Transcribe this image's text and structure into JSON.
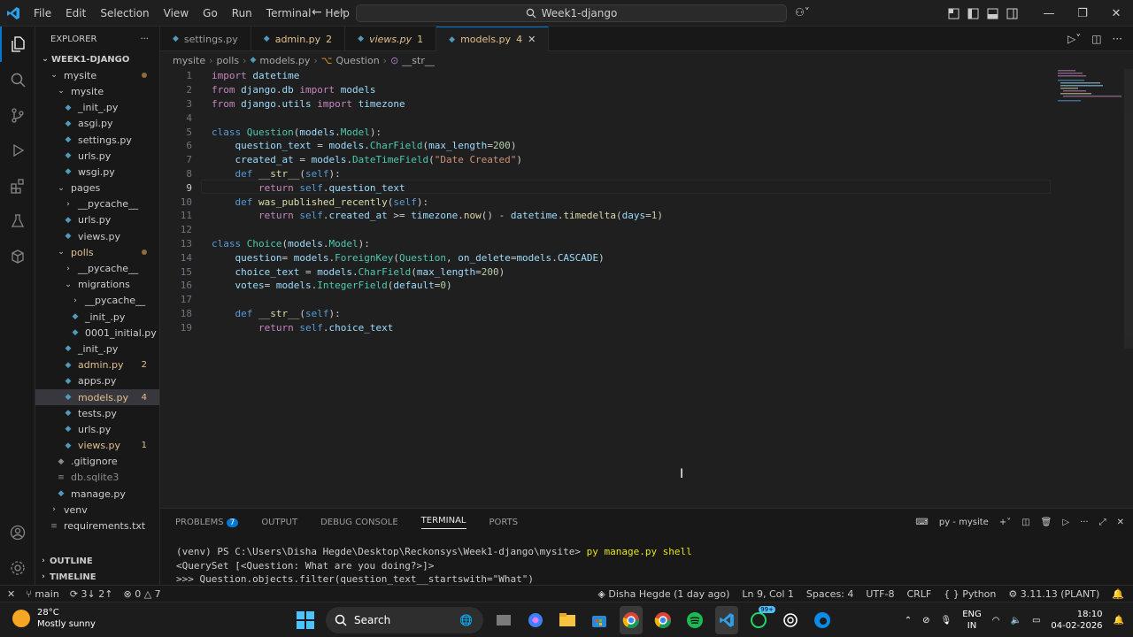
{
  "titlebar": {
    "menu": [
      "File",
      "Edit",
      "Selection",
      "View",
      "Go",
      "Run",
      "Terminal",
      "Help"
    ],
    "search_text": "Week1-django"
  },
  "sidebar": {
    "header": "EXPLORER",
    "root": "WEEK1-DJANGO",
    "tree": [
      {
        "label": "mysite",
        "depth": 0,
        "type": "folder",
        "open": true,
        "status": "dot"
      },
      {
        "label": "mysite",
        "depth": 1,
        "type": "folder",
        "open": true
      },
      {
        "label": "_init_.py",
        "depth": 2,
        "type": "py"
      },
      {
        "label": "asgi.py",
        "depth": 2,
        "type": "py"
      },
      {
        "label": "settings.py",
        "depth": 2,
        "type": "py"
      },
      {
        "label": "urls.py",
        "depth": 2,
        "type": "py"
      },
      {
        "label": "wsgi.py",
        "depth": 2,
        "type": "py"
      },
      {
        "label": "pages",
        "depth": 1,
        "type": "folder",
        "open": true
      },
      {
        "label": "__pycache__",
        "depth": 2,
        "type": "folder",
        "open": false
      },
      {
        "label": "urls.py",
        "depth": 2,
        "type": "py"
      },
      {
        "label": "views.py",
        "depth": 2,
        "type": "py"
      },
      {
        "label": "polls",
        "depth": 1,
        "type": "folder",
        "open": true,
        "status": "dot",
        "mod": true
      },
      {
        "label": "__pycache__",
        "depth": 2,
        "type": "folder",
        "open": false
      },
      {
        "label": "migrations",
        "depth": 2,
        "type": "folder",
        "open": true
      },
      {
        "label": "__pycache__",
        "depth": 3,
        "type": "folder",
        "open": false
      },
      {
        "label": "_init_.py",
        "depth": 3,
        "type": "py"
      },
      {
        "label": "0001_initial.py",
        "depth": 3,
        "type": "py"
      },
      {
        "label": "_init_.py",
        "depth": 2,
        "type": "py"
      },
      {
        "label": "admin.py",
        "depth": 2,
        "type": "py",
        "badge": "2",
        "mod": true
      },
      {
        "label": "apps.py",
        "depth": 2,
        "type": "py"
      },
      {
        "label": "models.py",
        "depth": 2,
        "type": "py",
        "badge": "4",
        "mod": true,
        "selected": true
      },
      {
        "label": "tests.py",
        "depth": 2,
        "type": "py"
      },
      {
        "label": "urls.py",
        "depth": 2,
        "type": "py"
      },
      {
        "label": "views.py",
        "depth": 2,
        "type": "py",
        "badge": "1",
        "mod": true
      },
      {
        "label": ".gitignore",
        "depth": 1,
        "type": "git"
      },
      {
        "label": "db.sqlite3",
        "depth": 1,
        "type": "db",
        "dim": true
      },
      {
        "label": "manage.py",
        "depth": 1,
        "type": "py"
      },
      {
        "label": "venv",
        "depth": 0,
        "type": "folder",
        "open": false
      },
      {
        "label": "requirements.txt",
        "depth": 0,
        "type": "txt"
      }
    ],
    "outline": "OUTLINE",
    "timeline": "TIMELINE"
  },
  "tabs": [
    {
      "label": "settings.py",
      "badge": "",
      "style": "normal"
    },
    {
      "label": "admin.py",
      "badge": "2",
      "style": "mod"
    },
    {
      "label": "views.py",
      "badge": "1",
      "style": "err"
    },
    {
      "label": "models.py",
      "badge": "4",
      "style": "active"
    }
  ],
  "breadcrumb": [
    "mysite",
    "polls",
    "models.py",
    "Question",
    "__str__"
  ],
  "editor": {
    "current_line": 9,
    "lines": [
      "import datetime",
      "from django.db import models",
      "from django.utils import timezone",
      "",
      "class Question(models.Model):",
      "    question_text = models.CharField(max_length=200)",
      "    created_at = models.DateTimeField(\"Date Created\")",
      "    def __str__(self):",
      "        return self.question_text",
      "    def was_published_recently(self):",
      "        return self.created_at >= timezone.now() - datetime.timedelta(days=1)",
      "",
      "class Choice(models.Model):",
      "    question= models.ForeignKey(Question, on_delete=models.CASCADE)",
      "    choice_text = models.CharField(max_length=200)",
      "    votes= models.IntegerField(default=0)",
      "",
      "    def __str__(self):",
      "        return self.choice_text"
    ]
  },
  "panel": {
    "tabs": [
      "PROBLEMS",
      "OUTPUT",
      "DEBUG CONSOLE",
      "TERMINAL",
      "PORTS"
    ],
    "problems_count": "7",
    "terminal_name": "py - mysite",
    "terminal": {
      "prompt": "(venv) PS C:\\Users\\Disha Hegde\\Desktop\\Reckonsys\\Week1-django\\mysite> ",
      "command": "py manage.py shell",
      "out1": "<QuerySet [<Question: What are you doing?>]>",
      "out2": ">>> Question.objects.filter(question_text__startswith=\"What\")"
    }
  },
  "statusbar": {
    "branch": "main",
    "sync": "3↓ 2↑",
    "errors": "0",
    "warnings": "7",
    "blame": "Disha Hegde (1 day ago)",
    "position": "Ln 9, Col 1",
    "spaces": "Spaces: 4",
    "encoding": "UTF-8",
    "eol": "CRLF",
    "language": "Python",
    "interpreter": "3.11.13 (PLANT)"
  },
  "taskbar": {
    "temp": "28°C",
    "weather": "Mostly sunny",
    "search": "Search",
    "notif_badge": "99+",
    "lang1": "ENG",
    "lang2": "IN",
    "time": "18:10",
    "date": "04-02-2026"
  }
}
